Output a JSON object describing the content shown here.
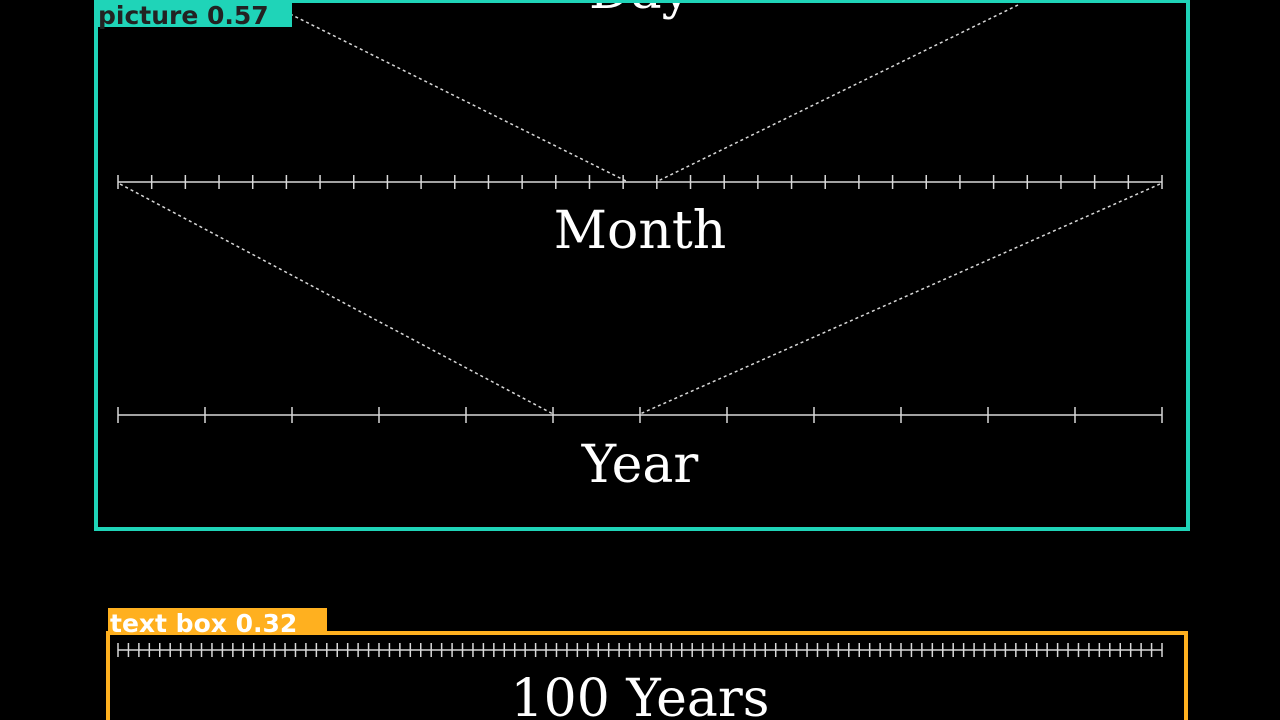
{
  "scales": {
    "day": {
      "label": "Day",
      "ticks": 0
    },
    "month": {
      "label": "Month",
      "ticks": 31
    },
    "year": {
      "label": "Year",
      "ticks": 12
    },
    "century": {
      "label": "100 Years",
      "ticks": 100
    }
  },
  "detections": {
    "picture": {
      "label": "picture",
      "score": "0.57",
      "text": "picture 0.57",
      "color": "#1fd4b8"
    },
    "text_box": {
      "label": "text box",
      "score": "0.32",
      "text": "text box 0.32",
      "color": "#ffb01f"
    }
  },
  "colors": {
    "background": "#000000",
    "axis": "#d8d8d8",
    "label_text": "#ffffff",
    "picture_box": "#1fd4b8",
    "text_box": "#ffb01f",
    "detection_label_text": "#222222"
  }
}
